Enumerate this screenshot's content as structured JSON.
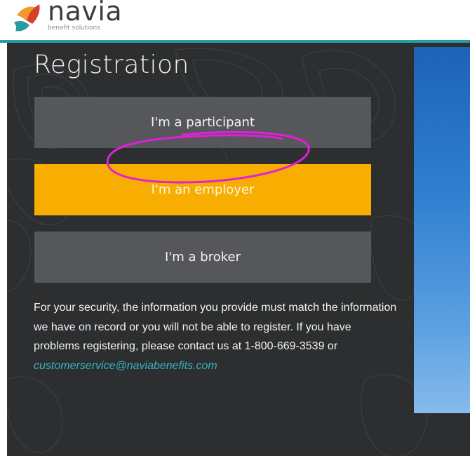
{
  "brand": {
    "name": "navia",
    "tagline": "benefit solutions",
    "colors": {
      "teal": "#2a9aa3",
      "red": "#d9402b",
      "orange": "#f19a2b",
      "dark": "#2c2e30"
    }
  },
  "registration": {
    "title": "Registration",
    "buttons": {
      "participant": "I'm a participant",
      "employer": "I'm an employer",
      "broker": "I'm a broker"
    },
    "info": {
      "text": "For your security, the information you provide must match the information we have on record or you will not be able to register. If you have problems registering, please contact us at 1-800-669-3539 or",
      "email": "customerservice@naviabenefits.com"
    }
  },
  "annotation": {
    "color": "#e21fd8",
    "shape": "hand-drawn-circle"
  },
  "icons": [
    "navia-logo-icon"
  ]
}
